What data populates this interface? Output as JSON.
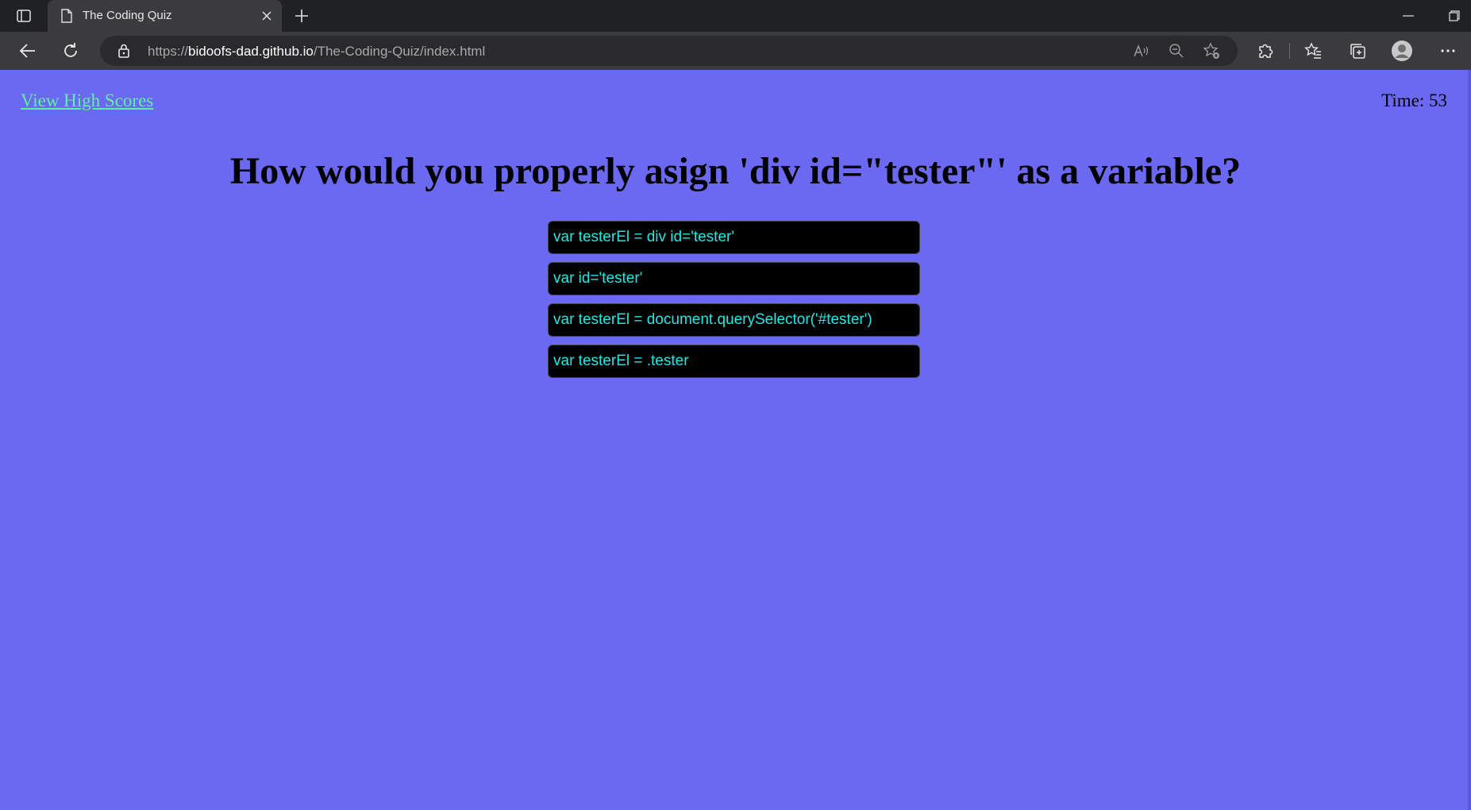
{
  "browser": {
    "tab_title": "The Coding Quiz",
    "url_prefix": "https://",
    "url_host": "bidoofs-dad.github.io",
    "url_path": "/The-Coding-Quiz/index.html"
  },
  "page": {
    "high_scores_link": "View High Scores",
    "timer_label": "Time: ",
    "timer_value": "53",
    "question": "How would you properly asign 'div id=\"tester\"' as a variable?",
    "answers": [
      "var testerEl = div id='tester'",
      "var id='tester'",
      "var testerEl = document.querySelector('#tester')",
      "var testerEl = .tester"
    ]
  },
  "colors": {
    "background": "#6b69f1",
    "link": "#5ff0a0",
    "answer_bg": "#000000",
    "answer_text": "#24e6e6"
  },
  "icons": {
    "sidebar": "sidebar-toggle-icon",
    "page": "page-icon",
    "close": "close-icon",
    "new_tab": "plus-icon",
    "back": "back-arrow-icon",
    "reload": "reload-icon",
    "lock": "lock-icon",
    "read_aloud": "read-aloud-icon",
    "zoom": "zoom-out-icon",
    "favorite_add": "star-add-icon",
    "extensions": "puzzle-icon",
    "favorites": "favorites-icon",
    "collections": "collections-icon",
    "profile": "profile-icon",
    "more": "more-icon"
  }
}
